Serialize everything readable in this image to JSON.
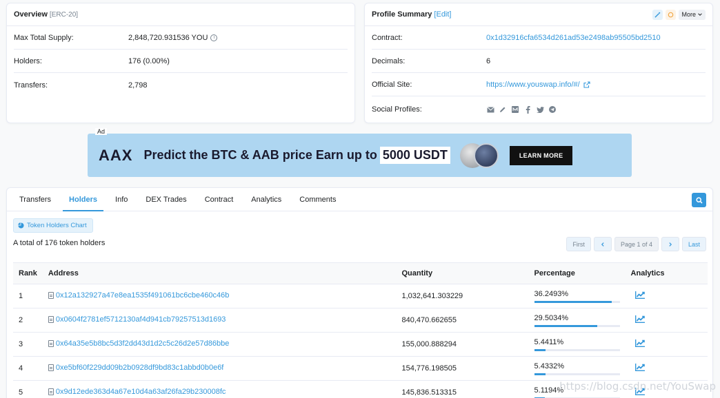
{
  "overview": {
    "title": "Overview",
    "standard": "[ERC-20]",
    "rows": [
      {
        "label": "Max Total Supply:",
        "value": "2,848,720.931536 YOU"
      },
      {
        "label": "Holders:",
        "value": "176 (0.00%)"
      },
      {
        "label": "Transfers:",
        "value": "2,798"
      }
    ]
  },
  "profile": {
    "title": "Profile Summary",
    "edit": "[Edit]",
    "more": "More",
    "contract_label": "Contract:",
    "contract_value": "0x1d32916cfa6534d261ad53e2498ab95505bd2510",
    "decimals_label": "Decimals:",
    "decimals_value": "6",
    "site_label": "Official Site:",
    "site_value": "https://www.youswap.info/#/",
    "social_label": "Social Profiles:",
    "social_icons": [
      "email-icon",
      "pencil-icon",
      "medium-icon",
      "facebook-icon",
      "twitter-icon",
      "telegram-icon"
    ]
  },
  "ad": {
    "label": "Ad",
    "brand": "AAX",
    "text": "Predict the BTC & AAB price  Earn up to",
    "highlight": "5000 USDT",
    "cta": "LEARN MORE"
  },
  "tabs": [
    "Transfers",
    "Holders",
    "Info",
    "DEX Trades",
    "Contract",
    "Analytics",
    "Comments"
  ],
  "active_tab": "Holders",
  "holders": {
    "chart_button": "Token Holders Chart",
    "total_text": "A total of 176 token holders",
    "pager": {
      "first": "First",
      "page": "Page 1 of 4",
      "last": "Last"
    },
    "columns": [
      "Rank",
      "Address",
      "Quantity",
      "Percentage",
      "Analytics"
    ],
    "rows": [
      {
        "rank": "1",
        "address": "0x12a132927a47e8ea1535f491061bc6cbe460c46b",
        "quantity": "1,032,641.303229",
        "percentage": "36.2493%",
        "pct": 36.2493
      },
      {
        "rank": "2",
        "address": "0x0604f2781ef5712130af4d941cb79257513d1693",
        "quantity": "840,470.662655",
        "percentage": "29.5034%",
        "pct": 29.5034
      },
      {
        "rank": "3",
        "address": "0x64a35e5b8bc5d3f2dd43d1d2c5c26d2e57d86bbe",
        "quantity": "155,000.888294",
        "percentage": "5.4411%",
        "pct": 5.4411
      },
      {
        "rank": "4",
        "address": "0xe5bf60f229dd09b2b0928df9bd83c1abbd0b0e6f",
        "quantity": "154,776.198505",
        "percentage": "5.4332%",
        "pct": 5.4332
      },
      {
        "rank": "5",
        "address": "0x9d12ede363d4a67e10d4a63af26fa29b230008fc",
        "quantity": "145,836.513315",
        "percentage": "5.1194%",
        "pct": 5.1194
      }
    ]
  },
  "watermark": "https://blog.csdn.net/YouSwap",
  "colors": {
    "accent": "#3498db",
    "text": "#1e2022",
    "muted": "#77838f",
    "border": "#e7eaf3",
    "banner": "#aed6f1"
  }
}
